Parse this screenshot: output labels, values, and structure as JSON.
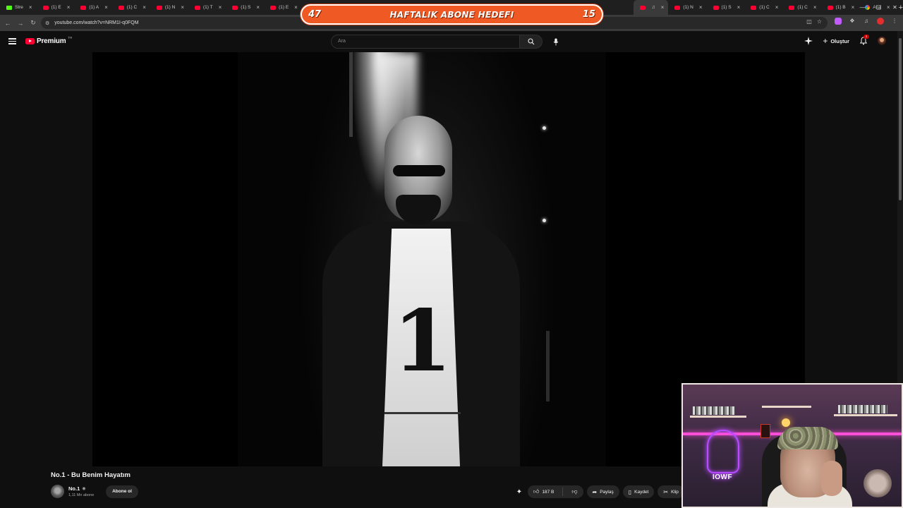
{
  "browser": {
    "tabs": [
      {
        "icon": "kick-favicon",
        "title": "Stre",
        "active": false
      },
      {
        "icon": "youtube-favicon",
        "title": "(1) E",
        "active": false
      },
      {
        "icon": "youtube-favicon",
        "title": "(1) A",
        "active": false
      },
      {
        "icon": "youtube-favicon",
        "title": "(1) C",
        "active": false
      },
      {
        "icon": "youtube-favicon",
        "title": "(1) N",
        "active": false
      },
      {
        "icon": "youtube-favicon",
        "title": "(1) T",
        "active": false
      },
      {
        "icon": "youtube-favicon",
        "title": "(1) S",
        "active": false
      },
      {
        "icon": "youtube-favicon",
        "title": "(1) E",
        "active": false
      },
      {
        "icon": "youtube-favicon",
        "title": "(1)",
        "active": false
      }
    ],
    "tabs_right": [
      {
        "icon": "youtube-favicon",
        "title": "",
        "active": true
      },
      {
        "icon": "youtube-favicon",
        "title": "(1) N",
        "active": false
      },
      {
        "icon": "youtube-favicon",
        "title": "(1) S",
        "active": false
      },
      {
        "icon": "youtube-favicon",
        "title": "(1) C",
        "active": false
      },
      {
        "icon": "youtube-favicon",
        "title": "(1) C",
        "active": false
      },
      {
        "icon": "youtube-favicon",
        "title": "(1) B",
        "active": false
      },
      {
        "icon": "google-favicon",
        "title": "Ana",
        "active": false
      }
    ],
    "url": "youtube.com/watch?v=NRM1I-q0FQM"
  },
  "overlay": {
    "left_count": "47",
    "goal_label": "HAFTALIK ABONE HEDEFI",
    "right_count": "15",
    "accent_color": "#ef5a24"
  },
  "youtube": {
    "logo_text": "Premium",
    "country_code": "TR",
    "search_placeholder": "Ara",
    "create_label": "Oluştur",
    "notification_count": "1"
  },
  "video": {
    "title": "No.1 - Bu Benim Hayatım",
    "jersey_number": "1",
    "channel_name": "No.1",
    "subscriber_count": "1,11 Mn abone",
    "subscribe_label": "Abone ol",
    "like_count": "187 B",
    "share_label": "Paylaş",
    "save_label": "Kaydet",
    "clip_label": "Klip"
  },
  "webcam": {
    "neon_sign_text": "IOWF"
  }
}
